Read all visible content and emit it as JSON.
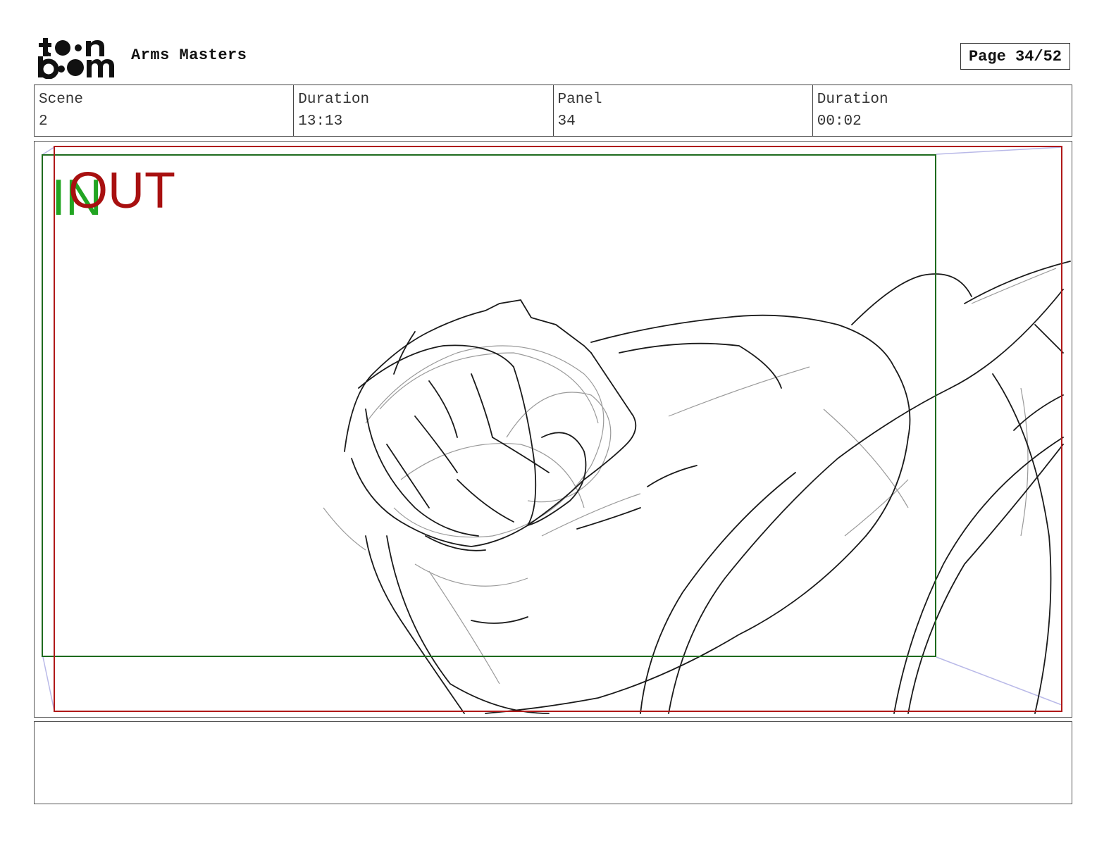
{
  "header": {
    "logo_text": "toon boom",
    "project_title": "Arms Masters",
    "page_label": "Page 34/52"
  },
  "info": [
    {
      "label": "Scene",
      "value": "2"
    },
    {
      "label": "Duration",
      "value": "13:13"
    },
    {
      "label": "Panel",
      "value": "34"
    },
    {
      "label": "Duration",
      "value": "00:02"
    }
  ],
  "panel": {
    "camera_in_label": "IN",
    "camera_out_label": "OUT",
    "in_frame_color": "#1e6b1e",
    "out_frame_color": "#b01818",
    "sketch_description_icon": "sketch-drawing"
  },
  "notes": {
    "text": ""
  }
}
